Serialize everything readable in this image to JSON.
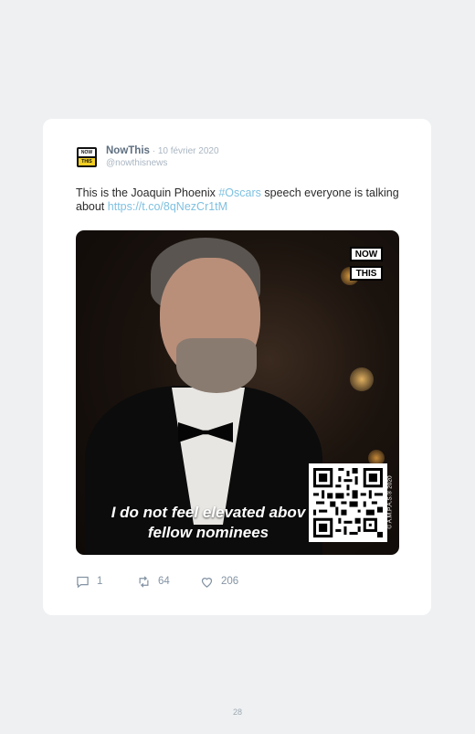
{
  "tweet": {
    "account_name": "NowThis",
    "date_sep": " · ",
    "date": "10 février 2020",
    "handle": "@nowthisnews",
    "avatar_line1": "NOW",
    "avatar_line2": "THIS",
    "text_before": "This is the Joaquin Phoenix ",
    "hashtag": "#Oscars",
    "text_after": " speech everyone is talking about ",
    "link": "https://t.co/8qNezCr1tM",
    "media": {
      "logo_line1": "NOW",
      "logo_line2": "THIS",
      "subtitle_line1": "I do not feel elevated abov",
      "subtitle_line2": "fellow nominees",
      "copyright": "© A.M.P.A.S.® 2020",
      "qr_icon": "qr-code-icon"
    },
    "actions": {
      "reply_count": "1",
      "retweet_count": "64",
      "like_count": "206",
      "reply_icon": "reply-icon",
      "retweet_icon": "retweet-icon",
      "like_icon": "heart-icon"
    }
  },
  "page": {
    "number": "28"
  },
  "colors": {
    "link": "#7fc1e0",
    "name": "#5e6f80",
    "muted": "#aab6c2",
    "background": "#eef0f2"
  }
}
